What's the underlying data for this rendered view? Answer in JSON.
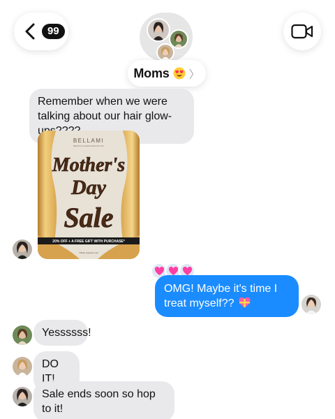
{
  "header": {
    "back_badge": "99",
    "group_name": "Moms",
    "group_emoji": "heart-eyes-emoji",
    "chevron": "〉"
  },
  "messages": [
    {
      "from": "in",
      "text": "Remember when we were talking about our hair glow-ups????"
    },
    {
      "from": "in",
      "type": "image",
      "ad": {
        "brand": "BELLAMI",
        "brand_tagline": "BEAUTIFUL & ELEGANCE FOR YOU",
        "line1": "Mother's",
        "line2": "Day",
        "line3": "Sale",
        "banner": "20% OFF + A FREE GIFT WITH PURCHASE*",
        "fine_print": "*While Supplies Last"
      }
    },
    {
      "from": "out",
      "text": "OMG! Maybe it's time I treat myself??",
      "reactions": [
        "heart",
        "heart",
        "heart"
      ],
      "emoji": "gift-heart-emoji"
    },
    {
      "from": "in",
      "text": "Yessssss!"
    },
    {
      "from": "in",
      "text": "DO IT!"
    },
    {
      "from": "in",
      "text": "Sale ends soon so hop to it!"
    }
  ],
  "colors": {
    "outgoing": "#1a8cff",
    "incoming": "#e9e9eb",
    "reaction": "#ff3fa4"
  }
}
